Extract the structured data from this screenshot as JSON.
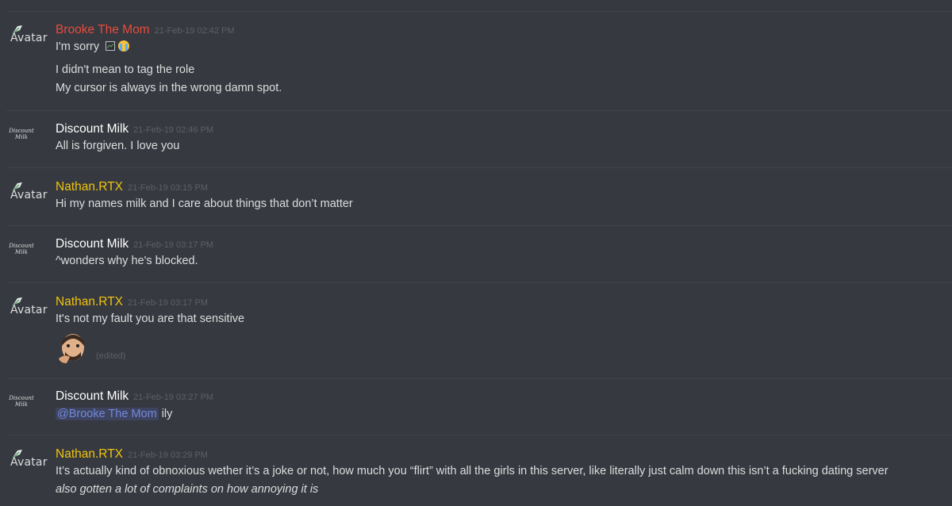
{
  "colors": {
    "background": "#36393f",
    "divider": "#40434a",
    "text": "#dcddde",
    "timestamp": "#5d6066",
    "brooke": "#e74c3c",
    "discount_milk": "#ffffff",
    "nathan": "#f1c40f",
    "mention_bg": "#3e4460",
    "mention_text": "#7289da"
  },
  "avatar_alt": "Avatar",
  "avatar_script": "Discount Milk",
  "messages": [
    {
      "username": "Brooke The Mom",
      "timestamp": "21-Feb-19 02:42 PM",
      "lines": [
        "I'm sorry",
        "I didn't mean to tag the role",
        "My cursor is always in the wrong damn spot."
      ]
    },
    {
      "username": "Discount Milk",
      "timestamp": "21-Feb-19 02:46 PM",
      "lines": [
        "All is forgiven. I love you"
      ]
    },
    {
      "username": "Nathan.RTX",
      "timestamp": "21-Feb-19 03:15 PM",
      "lines": [
        "Hi my names milk and I care about things that don’t matter"
      ]
    },
    {
      "username": "Discount Milk",
      "timestamp": "21-Feb-19 03:17 PM",
      "lines": [
        "^wonders why he's blocked."
      ]
    },
    {
      "username": "Nathan.RTX",
      "timestamp": "21-Feb-19 03:17 PM",
      "lines": [
        "It's not my fault you are that sensitive"
      ],
      "edited": "(edited)"
    },
    {
      "username": "Discount Milk",
      "timestamp": "21-Feb-19 03:27 PM",
      "mention": "@Brooke The Mom",
      "after_mention": "ily"
    },
    {
      "username": "Nathan.RTX",
      "timestamp": "21-Feb-19 03:29 PM",
      "lines": [
        "It’s actually kind of obnoxious wether it’s a joke or not, how much you “flirt” with all the girls in this server, like literally just calm down this isn’t a fucking dating server",
        "also gotten a lot of complaints on how annoying it is"
      ]
    }
  ]
}
